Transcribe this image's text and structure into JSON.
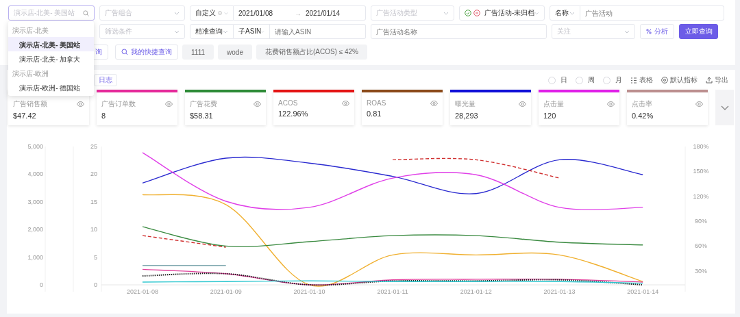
{
  "filters": {
    "row1": [
      {
        "kind": "search",
        "placeholder": "演示店-北美- 美国站"
      },
      {
        "kind": "select",
        "placeholder": "广告组合"
      },
      {
        "kind": "daterange",
        "preset": "自定义",
        "start": "2021/01/08",
        "arrow": "→",
        "end": "2021/01/14"
      },
      {
        "kind": "select",
        "placeholder": "广告活动类型"
      },
      {
        "kind": "status",
        "value": "广告活动-未归档"
      },
      {
        "kind": "namesearch",
        "field": "名称",
        "placeholder": "广告活动"
      }
    ],
    "row2": [
      {
        "kind": "select",
        "placeholder": "筛选条件"
      },
      {
        "kind": "asin",
        "mode": "精准查询",
        "field": "子ASIN",
        "placeholder": "请输入ASIN"
      },
      {
        "kind": "input",
        "placeholder": "广告活动名称"
      },
      {
        "kind": "select",
        "placeholder": "关注"
      },
      {
        "kind": "button",
        "label": "分析",
        "primary": false
      },
      {
        "kind": "button",
        "label": "立即查询",
        "primary": true
      }
    ],
    "quick": [
      {
        "kind": "link",
        "label": "询"
      },
      {
        "kind": "search-link",
        "label": "我的快捷查询"
      },
      {
        "kind": "tag",
        "label": "1111"
      },
      {
        "kind": "tag",
        "label": "wode"
      },
      {
        "kind": "tag",
        "label": "花费销售额占比(ACOS) ≤ 42%"
      }
    ]
  },
  "store_menu": {
    "groups": [
      {
        "label": "演示店-北美",
        "options": [
          {
            "label": "演示店-北美- 美国站",
            "selected": true
          },
          {
            "label": "演示店-北美- 加拿大",
            "selected": false
          }
        ]
      },
      {
        "label": "演示店-欧洲",
        "options": [
          {
            "label": "演示店-欧洲- 德国站",
            "selected": false
          }
        ]
      }
    ]
  },
  "toolbar": {
    "log_button": "日志",
    "periods": [
      {
        "label": "日",
        "selected": false
      },
      {
        "label": "周",
        "selected": false
      },
      {
        "label": "月",
        "selected": false
      }
    ],
    "actions": [
      {
        "kind": "table",
        "label": "表格"
      },
      {
        "kind": "eye",
        "label": "默认指标"
      },
      {
        "kind": "export",
        "label": "导出"
      }
    ]
  },
  "metrics": [
    {
      "label": "广告销售额",
      "value": "$47.42"
    },
    {
      "label": "广告订单数",
      "value": "8",
      "color": "#e52a9a"
    },
    {
      "label": "广告花费",
      "value": "$58.31",
      "color": "#2e8b38"
    },
    {
      "label": "ACOS",
      "value": "122.96%",
      "color": "#e41414"
    },
    {
      "label": "ROAS",
      "value": "0.81",
      "color": "#8b4a1a"
    },
    {
      "label": "曝光量",
      "value": "28,293",
      "color": "#1010d8"
    },
    {
      "label": "点击量",
      "value": "120",
      "color": "#e020e8"
    },
    {
      "label": "点击率",
      "value": "0.42%",
      "color": "#bc8f8f"
    }
  ],
  "chart": {
    "left_axis": [
      "5,000",
      "4,000",
      "3,000",
      "2,000",
      "1,000",
      "0"
    ],
    "right_axis": [
      "180%",
      "150%",
      "120%",
      "90%",
      "60%",
      "30%"
    ],
    "chart_data": {
      "type": "line",
      "categories": [
        "2021-01-08",
        "2021-01-09",
        "2021-01-10",
        "2021-01-11",
        "2021-01-12",
        "2021-01-13",
        "2021-01-14"
      ],
      "ylim": [
        0,
        25
      ],
      "yticks": [
        0,
        5,
        10,
        15,
        20,
        25
      ],
      "series": [
        {
          "color": "#2a2ad0",
          "line_style": "solid",
          "values": [
            18.4,
            22.9,
            22,
            19.6,
            16.5,
            22.6,
            19.9
          ]
        },
        {
          "color": "#e040e8",
          "line_style": "solid",
          "values": [
            23.9,
            15.1,
            14,
            19.3,
            19.9,
            14,
            14
          ]
        },
        {
          "color": "#f0b030",
          "line_style": "solid",
          "values": [
            16.3,
            14.5,
            0,
            5.4,
            5.4,
            5.4,
            0.6
          ]
        },
        {
          "color": "#3a8a40",
          "line_style": "solid",
          "values": [
            10.5,
            7,
            7.8,
            8.9,
            8.9,
            7.7,
            7.2
          ]
        },
        {
          "color": "#d03030",
          "line_style": "dashed",
          "values": [
            8.9,
            6.8,
            null,
            22.6,
            22.6,
            19.3,
            null
          ]
        },
        {
          "color": "#80a8b0",
          "line_style": "solid",
          "values": [
            3.5,
            3.5,
            null,
            null,
            null,
            null,
            null
          ]
        },
        {
          "color": "#e0409a",
          "line_style": "solid",
          "values": [
            2.8,
            2,
            0,
            0.9,
            1,
            1,
            0.5
          ]
        },
        {
          "color": "#202020",
          "line_style": "dotted",
          "values": [
            1.6,
            2,
            0,
            0.7,
            0.7,
            0.9,
            0
          ]
        },
        {
          "color": "#30c8d0",
          "line_style": "solid",
          "values": [
            0.5,
            0.6,
            0.7,
            0.6,
            0.6,
            0.6,
            0.3
          ]
        }
      ]
    }
  }
}
